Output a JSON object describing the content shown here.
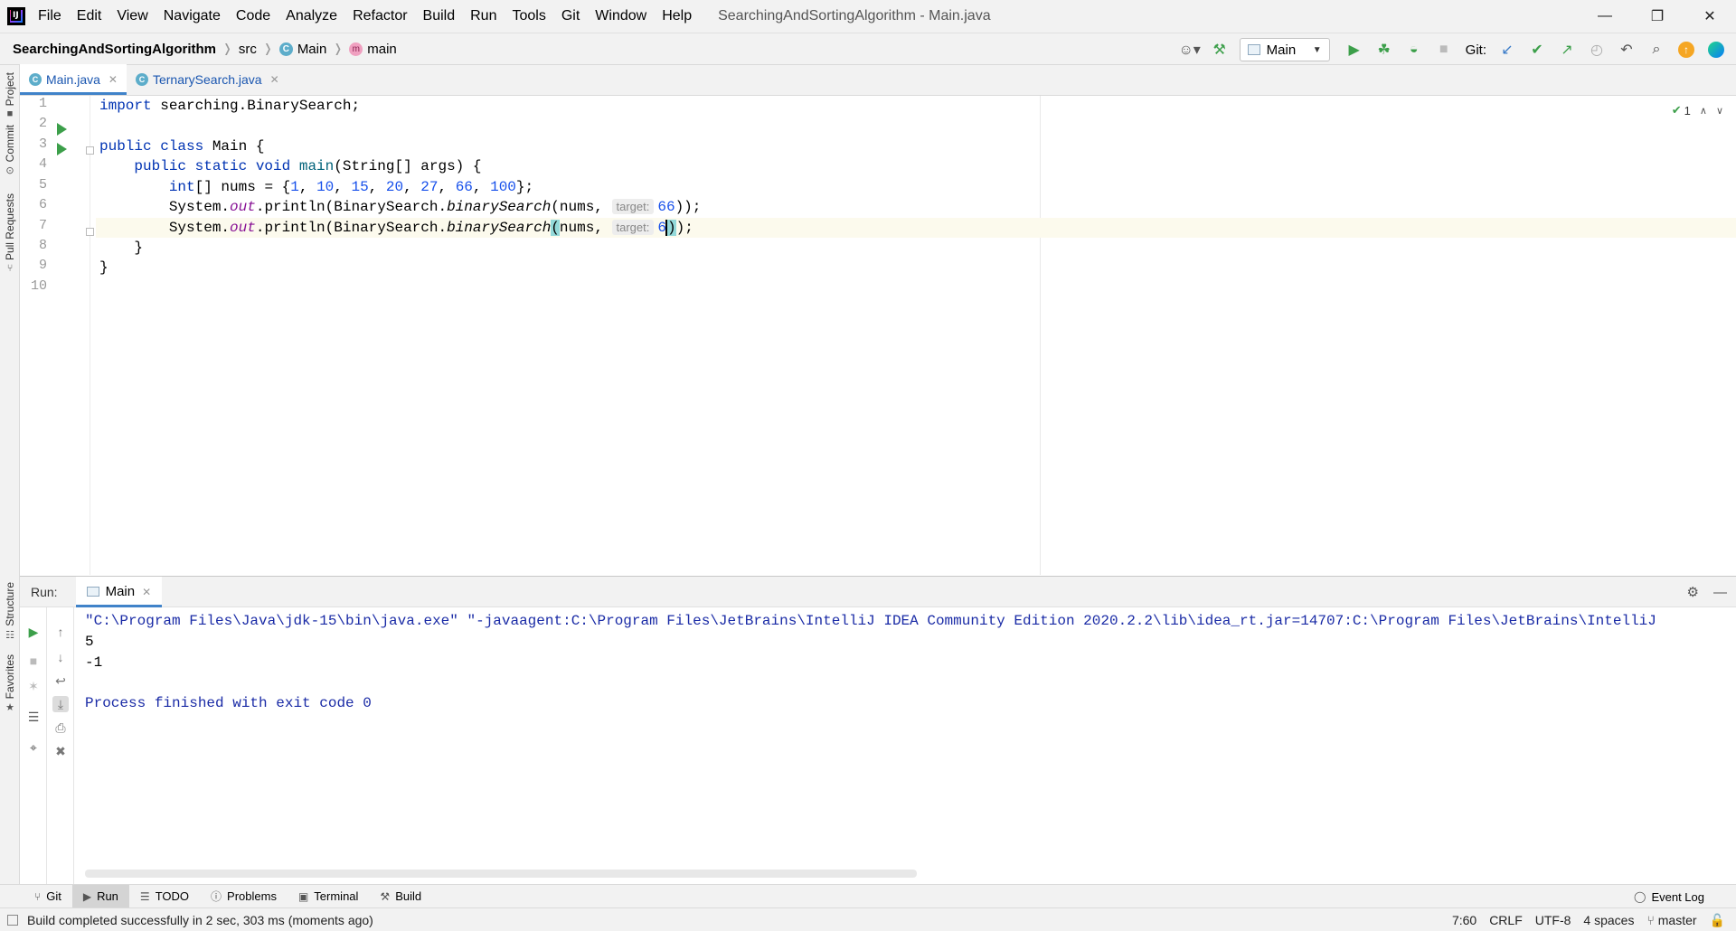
{
  "menu": [
    "File",
    "Edit",
    "View",
    "Navigate",
    "Code",
    "Analyze",
    "Refactor",
    "Build",
    "Run",
    "Tools",
    "Git",
    "Window",
    "Help"
  ],
  "window_title": "SearchingAndSortingAlgorithm - Main.java",
  "breadcrumb": {
    "project": "SearchingAndSortingAlgorithm",
    "folder": "src",
    "class": "Main",
    "method": "main"
  },
  "toolbar": {
    "run_config": "Main",
    "git_label": "Git:"
  },
  "left_stripe": {
    "project": "Project",
    "commit": "Commit",
    "pull_requests": "Pull Requests",
    "structure": "Structure",
    "favorites": "Favorites"
  },
  "editor_tabs": [
    {
      "label": "Main.java",
      "active": true
    },
    {
      "label": "TernarySearch.java",
      "active": false
    }
  ],
  "editor": {
    "line_numbers": [
      "1",
      "2",
      "3",
      "4",
      "5",
      "6",
      "7",
      "8",
      "9",
      "10"
    ],
    "inspection_count": "1",
    "lines": {
      "l1_kw": "import",
      "l1_rest": " searching.BinarySearch;",
      "l3_kw": "public class",
      "l3_rest": " Main {",
      "l4_kw": "public static void",
      "l4_fn": "main",
      "l4_rest": "(String[] args) {",
      "l5_kw": "int",
      "l5_a": "[] nums = {",
      "l5_nums": [
        "1",
        "10",
        "15",
        "20",
        "27",
        "66",
        "100"
      ],
      "l5_end": "};",
      "l6_sys": "System.",
      "l6_out": "out",
      "l6_println": ".println(BinarySearch.",
      "l6_call": "binarySearch",
      "l6_args": "(nums, ",
      "l6_hint": "target:",
      "l6_val": "66",
      "l6_end": "));",
      "l7_sys": "System.",
      "l7_out": "out",
      "l7_println": ".println(BinarySearch.",
      "l7_call": "binarySearch",
      "l7_paren": "(",
      "l7_args": "nums, ",
      "l7_hint": "target:",
      "l7_val": "6",
      "l7_close": ")",
      "l7_end": ");",
      "l8": "}",
      "l9": "}"
    }
  },
  "run_window": {
    "title": "Run:",
    "tab": "Main",
    "console": [
      "\"C:\\Program Files\\Java\\jdk-15\\bin\\java.exe\" \"-javaagent:C:\\Program Files\\JetBrains\\IntelliJ IDEA Community Edition 2020.2.2\\lib\\idea_rt.jar=14707:C:\\Program Files\\JetBrains\\IntelliJ",
      "5",
      "-1",
      "",
      "Process finished with exit code 0"
    ]
  },
  "bottom_tabs": [
    {
      "label": "Git",
      "icon": "git-branch-icon"
    },
    {
      "label": "Run",
      "icon": "run-icon",
      "active": true
    },
    {
      "label": "TODO",
      "icon": "list-icon"
    },
    {
      "label": "Problems",
      "icon": "problems-icon"
    },
    {
      "label": "Terminal",
      "icon": "terminal-icon"
    },
    {
      "label": "Build",
      "icon": "hammer-icon"
    }
  ],
  "event_log": "Event Log",
  "status": {
    "message": "Build completed successfully in 2 sec, 303 ms (moments ago)",
    "position": "7:60",
    "line_sep": "CRLF",
    "encoding": "UTF-8",
    "indent": "4 spaces",
    "branch": "master"
  },
  "colors": {
    "accent": "#4083c9",
    "run_green": "#3c9f4a",
    "keyword": "#0033b3",
    "number": "#1750eb"
  }
}
